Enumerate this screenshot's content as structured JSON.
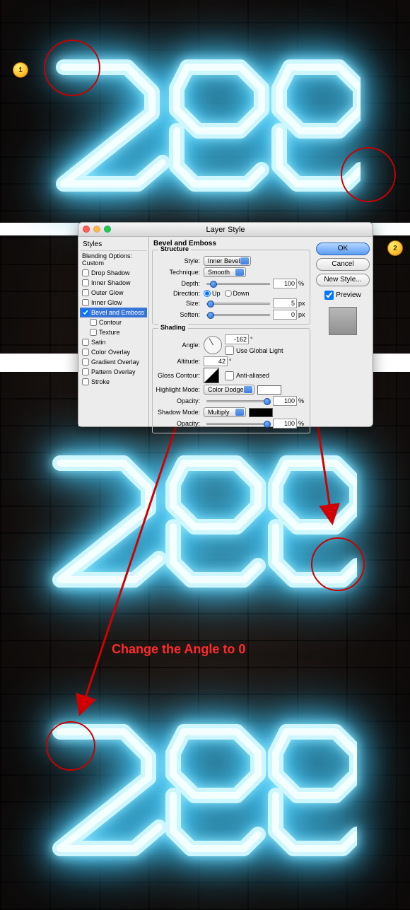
{
  "markers": {
    "one": "1",
    "two": "2"
  },
  "dialog": {
    "title": "Layer Style",
    "styles_header": "Styles",
    "blending_options": "Blending Options: Custom",
    "items": [
      {
        "label": "Drop Shadow",
        "checked": false
      },
      {
        "label": "Inner Shadow",
        "checked": false
      },
      {
        "label": "Outer Glow",
        "checked": false
      },
      {
        "label": "Inner Glow",
        "checked": false
      },
      {
        "label": "Bevel and Emboss",
        "checked": true,
        "selected": true
      },
      {
        "label": "Contour",
        "checked": false,
        "sub": true
      },
      {
        "label": "Texture",
        "checked": false,
        "sub": true
      },
      {
        "label": "Satin",
        "checked": false
      },
      {
        "label": "Color Overlay",
        "checked": false
      },
      {
        "label": "Gradient Overlay",
        "checked": false
      },
      {
        "label": "Pattern Overlay",
        "checked": false
      },
      {
        "label": "Stroke",
        "checked": false
      }
    ],
    "panel_title": "Bevel and Emboss",
    "structure": {
      "legend": "Structure",
      "style_label": "Style:",
      "style_value": "Inner Bevel",
      "technique_label": "Technique:",
      "technique_value": "Smooth",
      "depth_label": "Depth:",
      "depth_value": "100",
      "depth_unit": "%",
      "direction_label": "Direction:",
      "up": "Up",
      "down": "Down",
      "size_label": "Size:",
      "size_value": "5",
      "size_unit": "px",
      "soften_label": "Soften:",
      "soften_value": "0",
      "soften_unit": "px"
    },
    "shading": {
      "legend": "Shading",
      "angle_label": "Angle:",
      "angle_value": "-162",
      "angle_unit": "°",
      "global_light": "Use Global Light",
      "altitude_label": "Altitude:",
      "altitude_value": "42",
      "altitude_unit": "°",
      "gloss_label": "Gloss Contour:",
      "anti": "Anti-aliased",
      "highlight_mode_label": "Highlight Mode:",
      "highlight_mode_value": "Color Dodge",
      "highlight_color": "#ffffff",
      "highlight_opacity_label": "Opacity:",
      "highlight_opacity_value": "100",
      "pct": "%",
      "shadow_mode_label": "Shadow Mode:",
      "shadow_mode_value": "Multiply",
      "shadow_color": "#000000",
      "shadow_opacity_label": "Opacity:",
      "shadow_opacity_value": "100"
    },
    "buttons": {
      "ok": "OK",
      "cancel": "Cancel",
      "new_style": "New Style...",
      "preview": "Preview"
    }
  },
  "annotation": "Change the Angle to 0"
}
